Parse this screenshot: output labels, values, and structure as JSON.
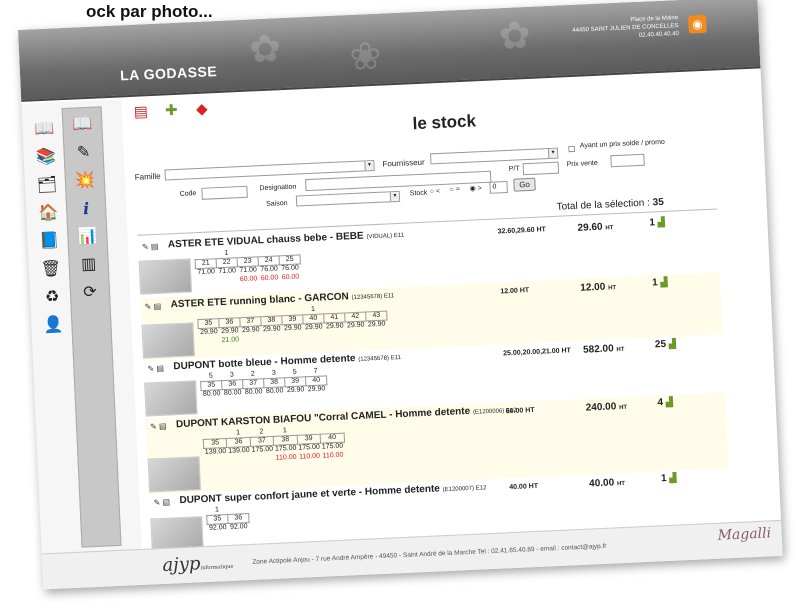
{
  "handwriting": "ock par photo...",
  "header": {
    "brand": "LA GODASSE",
    "address_line1": "Place de la Mairie",
    "address_line2": "44450 SAINT JULIEN DE CONCELLES",
    "address_line3": "02.40.40.40.40",
    "rss_icon": "rss-icon"
  },
  "sidebar": {
    "col1": [
      "book-open-icon",
      "books-icon",
      "document-stack-icon",
      "home-icon",
      "notepad-icon",
      "trash-can-icon",
      "recycle-icon",
      "user-icon"
    ],
    "col2": [
      "book-open-icon",
      "pencil-check-icon",
      "explosion-icon",
      "info-icon",
      "chart-icon",
      "barcode-icon",
      "refresh-icon"
    ]
  },
  "toolbar": {
    "icons": [
      "pdf-icon",
      "add-item-icon",
      "red-box-icon"
    ]
  },
  "title": "le stock",
  "filters": {
    "famille_label": "Famille",
    "fournisseur_label": "Fournisseur",
    "prix_solde_label": "Ayant un prix solde / promo",
    "pt_label": "P/T",
    "prix_vente_label": "Prix vente",
    "code_label": "Code",
    "designation_label": "Designation",
    "saison_label": "Saison",
    "stock_label": "Stock",
    "stock_lt": "<",
    "stock_eq": "=",
    "stock_gt": ">",
    "stock_value": "0",
    "go_label": "Go"
  },
  "total": {
    "label": "Total de la sélection :",
    "value": "35"
  },
  "products": [
    {
      "name": "ASTER ETE VIDUAL chauss bebe - BEBE",
      "ref": "(VIDUAL) E11",
      "purchase_price": "32.60,29.60 HT",
      "value": "29.60",
      "value_unit": "HT",
      "qty": "1",
      "stock_row": [
        "",
        "1",
        "",
        "",
        ""
      ],
      "sizes": [
        "21",
        "22",
        "23",
        "24",
        "25"
      ],
      "prices": [
        "71.00",
        "71.00",
        "71.00",
        "76.00",
        "76.00"
      ],
      "sale_prices": [
        "",
        "",
        "60.00",
        "60.00",
        "60.00"
      ],
      "sale_color": "#e02020"
    },
    {
      "name": "ASTER ETE running blanc - GARCON",
      "ref": "(12345678) E11",
      "purchase_price": "12.00 HT",
      "value": "12.00",
      "value_unit": "HT",
      "qty": "1",
      "stock_row": [
        "",
        "",
        "",
        "",
        "",
        "1",
        "",
        "",
        ""
      ],
      "sizes": [
        "35",
        "36",
        "37",
        "38",
        "39",
        "40",
        "41",
        "42",
        "43"
      ],
      "prices": [
        "29.90",
        "29.90",
        "29.90",
        "29.90",
        "29.90",
        "29.90",
        "29.90",
        "29.90",
        "29.90"
      ],
      "sale_prices": [
        "",
        "21.00",
        "",
        "",
        "",
        "",
        "",
        "",
        ""
      ],
      "sale_color": "#2a8a2a"
    },
    {
      "name": "DUPONT botte bleue - Homme detente",
      "ref": "(12345678) E11",
      "purchase_price": "25.00,20.00,21.00 HT",
      "value": "582.00",
      "value_unit": "HT",
      "qty": "25",
      "stock_row": [
        "5",
        "3",
        "2",
        "3",
        "5",
        "7"
      ],
      "sizes": [
        "35",
        "36",
        "37",
        "38",
        "39",
        "40"
      ],
      "prices": [
        "80.00",
        "80.00",
        "80.00",
        "80.00",
        "29.90",
        "29.90"
      ],
      "sale_prices": [
        "",
        "",
        "",
        "",
        "",
        ""
      ],
      "sale_color": "#e02020"
    },
    {
      "name": "DUPONT KARSTON BIAFOU \"Corral CAMEL - Homme detente",
      "ref": "(E1200006) E12",
      "purchase_price": "60.00 HT",
      "value": "240.00",
      "value_unit": "HT",
      "qty": "4",
      "stock_row": [
        "",
        "1",
        "2",
        "1",
        "",
        ""
      ],
      "sizes": [
        "35",
        "36",
        "37",
        "38",
        "39",
        "40"
      ],
      "prices": [
        "139.00",
        "139.00",
        "175.00",
        "175.00",
        "175.00",
        "175.00"
      ],
      "sale_prices": [
        "",
        "",
        "",
        "110.00",
        "110.00",
        "110.00"
      ],
      "sale_color": "#e02020"
    },
    {
      "name": "DUPONT super confort jaune et verte - Homme detente",
      "ref": "(E1200007) E12",
      "purchase_price": "40.00 HT",
      "value": "40.00",
      "value_unit": "HT",
      "qty": "1",
      "stock_row": [
        "1",
        ""
      ],
      "sizes": [
        "35",
        "36"
      ],
      "prices": [
        "92.00",
        "92.00"
      ],
      "sale_prices": [
        "",
        ""
      ],
      "sale_color": "#e02020"
    }
  ],
  "footer": {
    "logo": "ajyp",
    "logo_sub": "informatique",
    "text": "Zone Actipole Anjou - 7 rue André Ampère - 49450 - Saint André de la Marche    Tel : 02.41.65.40.89 - email : contact@ajyp.fr",
    "signature": "Magalli"
  }
}
